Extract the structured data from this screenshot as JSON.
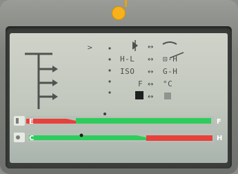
{
  "device": {
    "indicator_color": "#f7b11a"
  },
  "lcd": {
    "left_labels": [
      ">",
      ">",
      ">"
    ],
    "rows": [
      {
        "left": "H-L",
        "arrow": "↔",
        "right": "⊡-H"
      },
      {
        "left": "ISO",
        "arrow": "↔",
        "right": "G-H"
      },
      {
        "left": "F",
        "arrow": "↔",
        "right": "°C"
      }
    ],
    "bottom_left_icon": "black-square-icon",
    "bottom_right_icon": "gray-square-icon"
  },
  "bars": [
    {
      "left_label": "E",
      "right_label": "F",
      "level": 0.25,
      "colors": {
        "red": "#e8403a",
        "green": "#2ecc5c"
      }
    },
    {
      "left_label": "C",
      "right_label": "H",
      "level": 0.55,
      "colors": {
        "green": "#2ecc5c",
        "red": "#e8403a"
      }
    }
  ]
}
